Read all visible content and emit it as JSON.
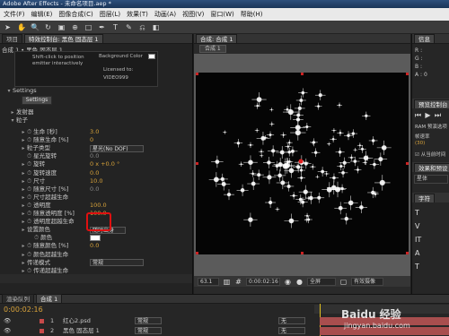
{
  "window": {
    "title": "Adobe After Effects - 未命名项目.aep *"
  },
  "menu": [
    "文件(F)",
    "编辑(E)",
    "图像合成(C)",
    "图层(L)",
    "效果(T)",
    "动画(A)",
    "视图(V)",
    "窗口(W)",
    "帮助(H)"
  ],
  "left_panel": {
    "tabs": [
      "项目",
      "特效控制台: 黑色 固态层 1"
    ],
    "header": "合成 1 • 黑色 固态层 1",
    "preview_hint_1": "Shift-click to position",
    "preview_hint_2": "emitter interactively",
    "background_color_label": "Background Color",
    "licensed_to": "Licensed to:",
    "license_id": "VIDEO999",
    "settings_label": "Settings",
    "settings_button": "Settings",
    "emitter_label": "发射器",
    "particle_label": "粒子",
    "properties": [
      {
        "label": "生命 [秒]",
        "value": "3.0"
      },
      {
        "label": "随意生命 [%]",
        "value": "0"
      },
      {
        "label": "粒子类型",
        "value": "星光(No DOF)"
      },
      {
        "label": "星光旋转",
        "value": "0.0"
      },
      {
        "label": "旋转",
        "value": "0 x +0.0 °"
      },
      {
        "label": "旋转速度",
        "value": "0.0"
      },
      {
        "label": "尺寸",
        "value": "10.0"
      },
      {
        "label": "随意尺寸 [%]",
        "value": "0.0"
      },
      {
        "label": "尺寸超越生命",
        "value": ""
      },
      {
        "label": "透明度",
        "value": "100.0"
      },
      {
        "label": "随意透明度 [%]",
        "value": "100.0"
      },
      {
        "label": "透明度超越生命",
        "value": ""
      },
      {
        "label": "设置颜色",
        "value": "随时出身"
      },
      {
        "label": "颜色",
        "value": ""
      },
      {
        "label": "随意颜色 [%]",
        "value": "0.0"
      },
      {
        "label": "颜色超越生命",
        "value": ""
      },
      {
        "label": "传递模式",
        "value": "常规"
      },
      {
        "label": "传递超越生命",
        "value": ""
      }
    ]
  },
  "composition": {
    "tab": "合成: 合成 1",
    "subtab": "合成 1",
    "zoom": "63.1",
    "timecode": "0:00:02:16",
    "view": "全屏",
    "camera": "有效摄像"
  },
  "right_panel": {
    "info_tab": "信息",
    "rgb": {
      "r": "R :",
      "g": "G :",
      "b": "B :",
      "a": "A : 0"
    },
    "preview_tab": "预览控制台",
    "ram_preview": "RAM 预演选项",
    "frame_rate_label": "帧速率",
    "frame_rate_value": "(30)",
    "from_current": "从当前时间",
    "effects_tab": "效果和预设",
    "effects_search": "星体",
    "char_tab": "字符",
    "char_size": "T"
  },
  "timeline": {
    "tabs": [
      "渲染队列",
      "合成 1"
    ],
    "timecode": "0:00:02:16",
    "layers": [
      {
        "num": "1",
        "name": "红心2.psd",
        "mode": "常规",
        "track": "无",
        "color": "#c74a4a"
      },
      {
        "num": "2",
        "name": "黑色 固态层 1",
        "mode": "常规",
        "track": "无",
        "color": "#c74a4a"
      }
    ]
  },
  "watermark": "Baidu 经验",
  "watermark_url": "jingyan.baidu.com",
  "colors": {
    "accent": "#d7a23a",
    "highlight_box": "#e01010",
    "timeline_bar": "#a84e4e"
  }
}
